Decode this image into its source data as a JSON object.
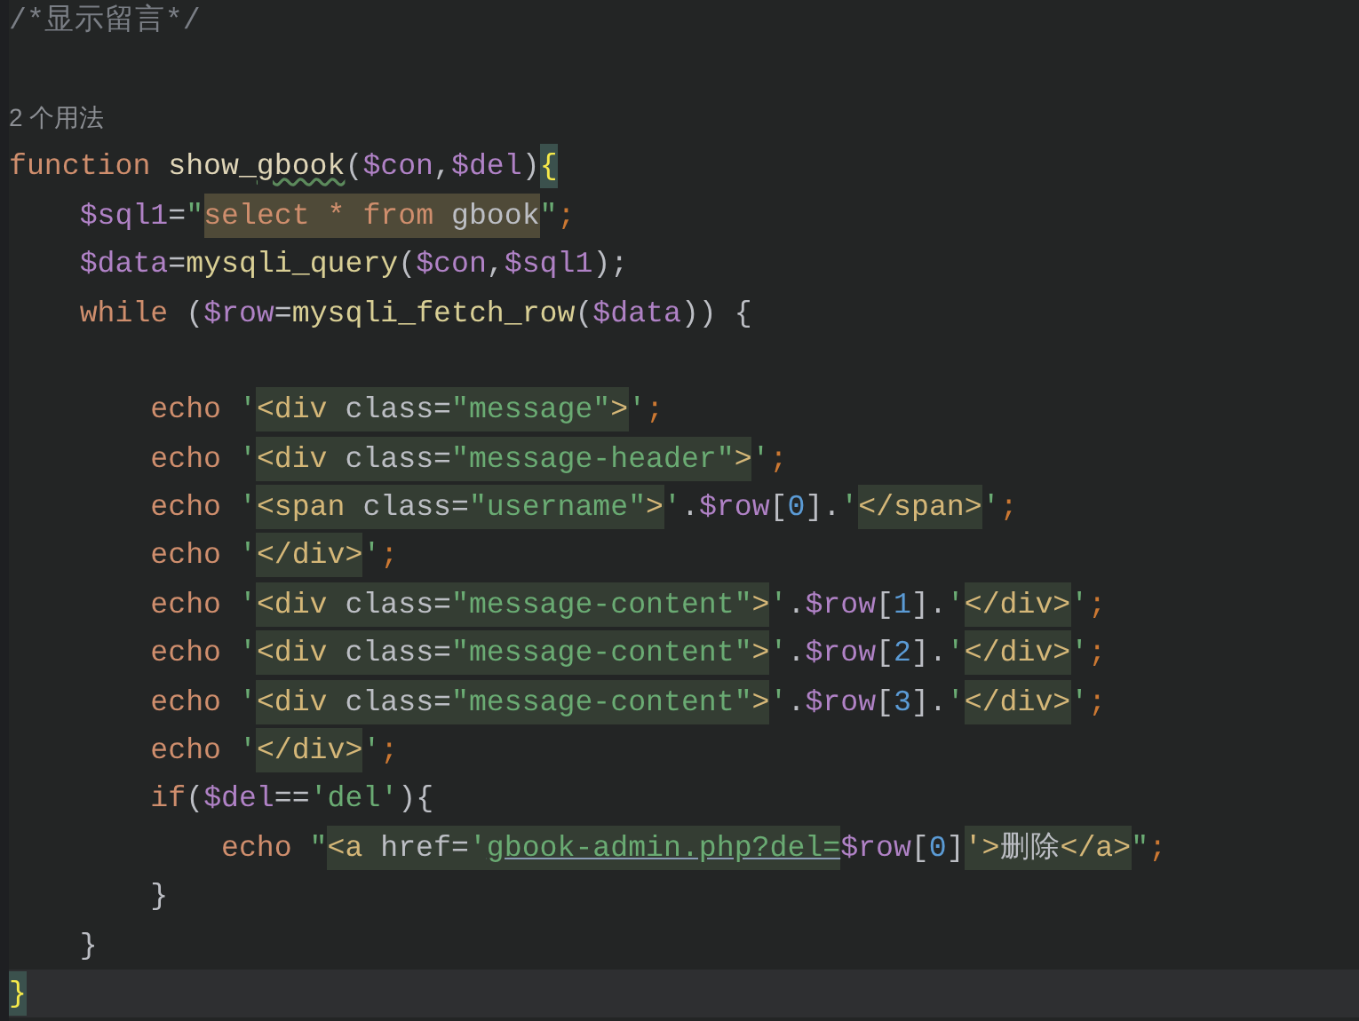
{
  "editor": {
    "lines": [
      {
        "current": false,
        "tokens": [
          {
            "text": "/*显示留言*/",
            "kind": "comment"
          }
        ]
      },
      {
        "current": false
      },
      {
        "current": false,
        "tokens": [
          {
            "text": "2 个用法",
            "kind": "hint"
          }
        ]
      },
      {
        "current": false,
        "tokens": [
          {
            "text": "function",
            "kind": "kw"
          },
          {
            "text": " show_",
            "kind": "fn"
          },
          {
            "text": "gbook",
            "kind": "typo"
          },
          {
            "text": "(",
            "kind": "punct"
          },
          {
            "text": "$con",
            "kind": "var"
          },
          {
            "text": ",",
            "kind": "punct"
          },
          {
            "text": "$del",
            "kind": "var"
          },
          {
            "text": ")",
            "kind": "punct"
          },
          {
            "text": "{",
            "kind": "brace"
          }
        ]
      },
      {
        "current": false,
        "tokens": [
          {
            "text": "    $sql1",
            "kind": "var"
          },
          {
            "text": "=",
            "kind": "punct"
          },
          {
            "text": "\"",
            "kind": "str"
          },
          {
            "kind": "match",
            "tokens": [
              {
                "text": "select * from ",
                "kind": "sqlkw"
              },
              {
                "text": "gbook",
                "kind": "sqlid"
              }
            ]
          },
          {
            "text": "\"",
            "kind": "str"
          },
          {
            "text": ";",
            "kind": "semi"
          }
        ]
      },
      {
        "current": false,
        "tokens": [
          {
            "text": "    $data",
            "kind": "var"
          },
          {
            "text": "=",
            "kind": "punct"
          },
          {
            "text": "mysqli_query",
            "kind": "call"
          },
          {
            "text": "(",
            "kind": "punct"
          },
          {
            "text": "$con",
            "kind": "var"
          },
          {
            "text": ",",
            "kind": "punct"
          },
          {
            "text": "$sql1",
            "kind": "var"
          },
          {
            "text": ");",
            "kind": "punct"
          }
        ]
      },
      {
        "current": false,
        "tokens": [
          {
            "text": "    while",
            "kind": "kw"
          },
          {
            "text": " (",
            "kind": "punct"
          },
          {
            "text": "$row",
            "kind": "var"
          },
          {
            "text": "=",
            "kind": "punct"
          },
          {
            "text": "mysqli_fetch_row",
            "kind": "call"
          },
          {
            "text": "(",
            "kind": "punct"
          },
          {
            "text": "$data",
            "kind": "var"
          },
          {
            "text": ")) {",
            "kind": "punct"
          }
        ]
      },
      {
        "current": false
      },
      {
        "current": false,
        "tokens": [
          {
            "text": "        echo",
            "kind": "kw"
          },
          {
            "text": " '",
            "kind": "str"
          },
          {
            "kind": "injected",
            "tokens": [
              {
                "text": "<div",
                "kind": "tag"
              },
              {
                "text": " class=",
                "kind": "attr"
              },
              {
                "text": "\"message\"",
                "kind": "attrval"
              },
              {
                "text": ">",
                "kind": "tag"
              }
            ]
          },
          {
            "text": "'",
            "kind": "str"
          },
          {
            "text": ";",
            "kind": "semi"
          }
        ]
      },
      {
        "current": false,
        "tokens": [
          {
            "text": "        echo",
            "kind": "kw"
          },
          {
            "text": " '",
            "kind": "str"
          },
          {
            "kind": "injected",
            "tokens": [
              {
                "text": "<div",
                "kind": "tag"
              },
              {
                "text": " class=",
                "kind": "attr"
              },
              {
                "text": "\"message-header\"",
                "kind": "attrval"
              },
              {
                "text": ">",
                "kind": "tag"
              }
            ]
          },
          {
            "text": "'",
            "kind": "str"
          },
          {
            "text": ";",
            "kind": "semi"
          }
        ]
      },
      {
        "current": false,
        "tokens": [
          {
            "text": "        echo",
            "kind": "kw"
          },
          {
            "text": " '",
            "kind": "str"
          },
          {
            "kind": "injected",
            "tokens": [
              {
                "text": "<span",
                "kind": "tag"
              },
              {
                "text": " class=",
                "kind": "attr"
              },
              {
                "text": "\"username\"",
                "kind": "attrval"
              },
              {
                "text": ">",
                "kind": "tag"
              }
            ]
          },
          {
            "text": "'",
            "kind": "str"
          },
          {
            "text": ".",
            "kind": "punct"
          },
          {
            "text": "$row",
            "kind": "var"
          },
          {
            "text": "[",
            "kind": "punct"
          },
          {
            "text": "0",
            "kind": "num"
          },
          {
            "text": "].",
            "kind": "punct"
          },
          {
            "text": "'",
            "kind": "str"
          },
          {
            "kind": "injected",
            "tokens": [
              {
                "text": "</span>",
                "kind": "tag"
              }
            ]
          },
          {
            "text": "'",
            "kind": "str"
          },
          {
            "text": ";",
            "kind": "semi"
          }
        ]
      },
      {
        "current": false,
        "tokens": [
          {
            "text": "        echo",
            "kind": "kw"
          },
          {
            "text": " '",
            "kind": "str"
          },
          {
            "kind": "injected",
            "tokens": [
              {
                "text": "</div>",
                "kind": "tag"
              }
            ]
          },
          {
            "text": "'",
            "kind": "str"
          },
          {
            "text": ";",
            "kind": "semi"
          }
        ]
      },
      {
        "current": false,
        "tokens": [
          {
            "text": "        echo",
            "kind": "kw"
          },
          {
            "text": " '",
            "kind": "str"
          },
          {
            "kind": "injected",
            "tokens": [
              {
                "text": "<div",
                "kind": "tag"
              },
              {
                "text": " class=",
                "kind": "attr"
              },
              {
                "text": "\"message-content\"",
                "kind": "attrval"
              },
              {
                "text": ">",
                "kind": "tag"
              }
            ]
          },
          {
            "text": "'",
            "kind": "str"
          },
          {
            "text": ".",
            "kind": "punct"
          },
          {
            "text": "$row",
            "kind": "var"
          },
          {
            "text": "[",
            "kind": "punct"
          },
          {
            "text": "1",
            "kind": "num"
          },
          {
            "text": "].",
            "kind": "punct"
          },
          {
            "text": "'",
            "kind": "str"
          },
          {
            "kind": "injected",
            "tokens": [
              {
                "text": "</div>",
                "kind": "tag"
              }
            ]
          },
          {
            "text": "'",
            "kind": "str"
          },
          {
            "text": ";",
            "kind": "semi"
          }
        ]
      },
      {
        "current": false,
        "tokens": [
          {
            "text": "        echo",
            "kind": "kw"
          },
          {
            "text": " '",
            "kind": "str"
          },
          {
            "kind": "injected",
            "tokens": [
              {
                "text": "<div",
                "kind": "tag"
              },
              {
                "text": " class=",
                "kind": "attr"
              },
              {
                "text": "\"message-content\"",
                "kind": "attrval"
              },
              {
                "text": ">",
                "kind": "tag"
              }
            ]
          },
          {
            "text": "'",
            "kind": "str"
          },
          {
            "text": ".",
            "kind": "punct"
          },
          {
            "text": "$row",
            "kind": "var"
          },
          {
            "text": "[",
            "kind": "punct"
          },
          {
            "text": "2",
            "kind": "num"
          },
          {
            "text": "].",
            "kind": "punct"
          },
          {
            "text": "'",
            "kind": "str"
          },
          {
            "kind": "injected",
            "tokens": [
              {
                "text": "</div>",
                "kind": "tag"
              }
            ]
          },
          {
            "text": "'",
            "kind": "str"
          },
          {
            "text": ";",
            "kind": "semi"
          }
        ]
      },
      {
        "current": false,
        "tokens": [
          {
            "text": "        echo",
            "kind": "kw"
          },
          {
            "text": " '",
            "kind": "str"
          },
          {
            "kind": "injected",
            "tokens": [
              {
                "text": "<div",
                "kind": "tag"
              },
              {
                "text": " class=",
                "kind": "attr"
              },
              {
                "text": "\"message-content\"",
                "kind": "attrval"
              },
              {
                "text": ">",
                "kind": "tag"
              }
            ]
          },
          {
            "text": "'",
            "kind": "str"
          },
          {
            "text": ".",
            "kind": "punct"
          },
          {
            "text": "$row",
            "kind": "var"
          },
          {
            "text": "[",
            "kind": "punct"
          },
          {
            "text": "3",
            "kind": "num"
          },
          {
            "text": "].",
            "kind": "punct"
          },
          {
            "text": "'",
            "kind": "str"
          },
          {
            "kind": "injected",
            "tokens": [
              {
                "text": "</div>",
                "kind": "tag"
              }
            ]
          },
          {
            "text": "'",
            "kind": "str"
          },
          {
            "text": ";",
            "kind": "semi"
          }
        ]
      },
      {
        "current": false,
        "tokens": [
          {
            "text": "        echo",
            "kind": "kw"
          },
          {
            "text": " '",
            "kind": "str"
          },
          {
            "kind": "injected",
            "tokens": [
              {
                "text": "</div>",
                "kind": "tag"
              }
            ]
          },
          {
            "text": "'",
            "kind": "str"
          },
          {
            "text": ";",
            "kind": "semi"
          }
        ]
      },
      {
        "current": false,
        "tokens": [
          {
            "text": "        if",
            "kind": "kw"
          },
          {
            "text": "(",
            "kind": "punct"
          },
          {
            "text": "$del",
            "kind": "var"
          },
          {
            "text": "==",
            "kind": "punct"
          },
          {
            "text": "'del'",
            "kind": "str"
          },
          {
            "text": "){",
            "kind": "punct"
          }
        ]
      },
      {
        "current": false,
        "tokens": [
          {
            "text": "            echo",
            "kind": "kw"
          },
          {
            "text": " \"",
            "kind": "str"
          },
          {
            "kind": "injected",
            "tokens": [
              {
                "text": "<a",
                "kind": "tag"
              },
              {
                "text": " href=",
                "kind": "attr"
              },
              {
                "text": "'",
                "kind": "attrval"
              },
              {
                "text": "gbook-admin.php?del=",
                "kind": "link"
              }
            ]
          },
          {
            "text": "$row",
            "kind": "var"
          },
          {
            "text": "[",
            "kind": "punct"
          },
          {
            "text": "0",
            "kind": "num"
          },
          {
            "text": "]",
            "kind": "punct"
          },
          {
            "kind": "injected",
            "tokens": [
              {
                "text": "'>",
                "kind": "tag"
              },
              {
                "text": "删除",
                "kind": "plain"
              },
              {
                "text": "</a>",
                "kind": "tag"
              }
            ]
          },
          {
            "text": "\"",
            "kind": "str"
          },
          {
            "text": ";",
            "kind": "semi"
          }
        ]
      },
      {
        "current": false,
        "tokens": [
          {
            "text": "        }",
            "kind": "punct"
          }
        ]
      },
      {
        "current": false,
        "tokens": [
          {
            "text": "    }",
            "kind": "punct"
          }
        ]
      },
      {
        "current": true,
        "tokens": [
          {
            "text": "}",
            "kind": "brace"
          }
        ]
      }
    ]
  }
}
